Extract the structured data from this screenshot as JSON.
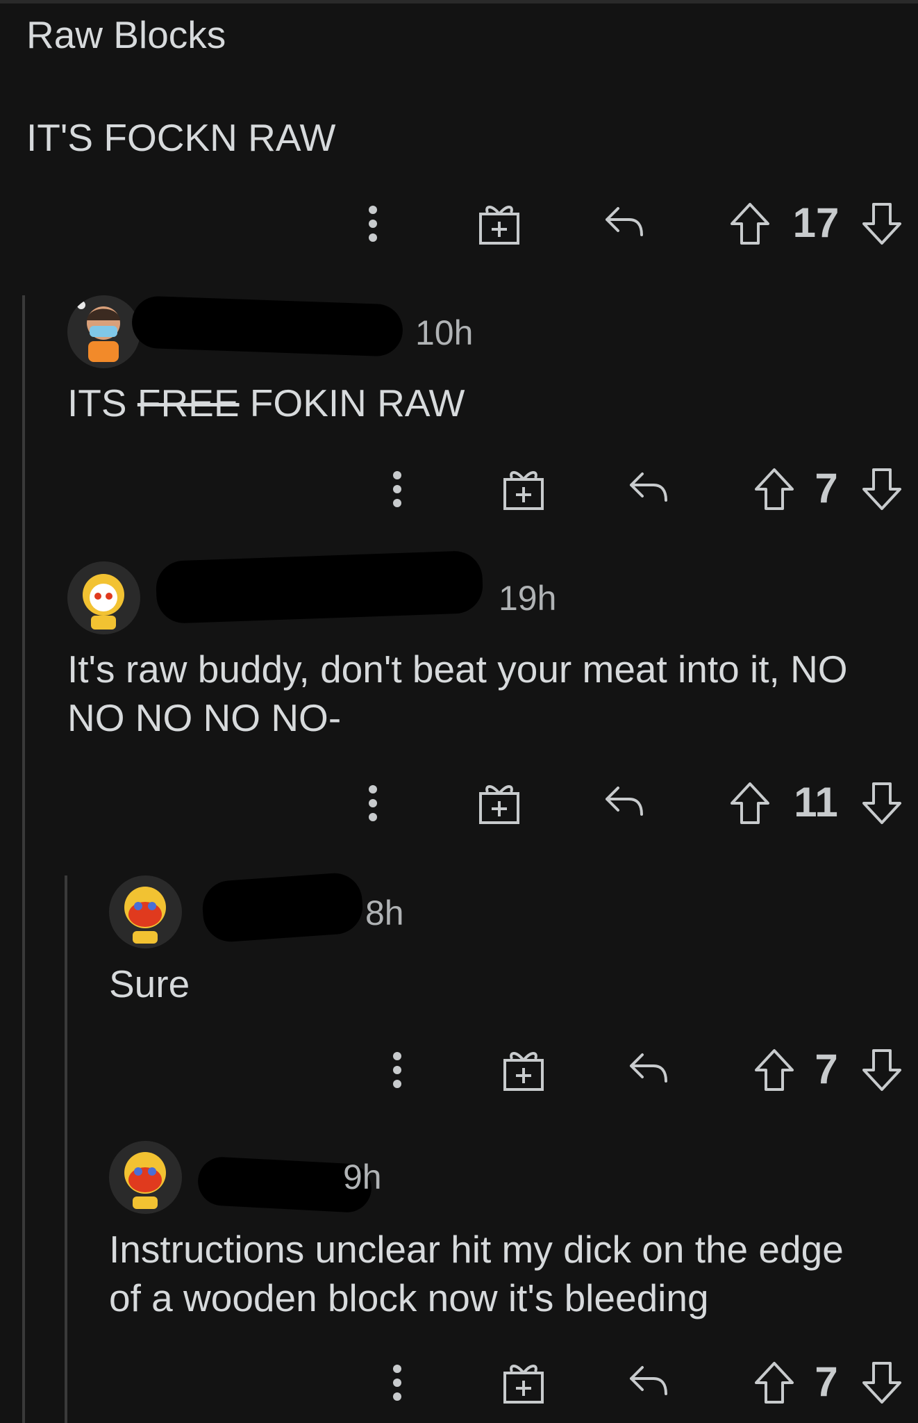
{
  "post": {
    "title": "Raw Blocks",
    "body": "IT'S FOCKN RAW",
    "score": "17"
  },
  "comments": [
    {
      "time": "10h",
      "text_prefix": "ITS ",
      "text_strike": "FREE",
      "text_suffix": " FOKIN RAW",
      "score": "7"
    },
    {
      "time": "19h",
      "line1": "It's raw buddy, don't beat your meat into it, NO",
      "line2": "NO NO NO NO-",
      "score": "11"
    },
    {
      "time": "8h",
      "text": "Sure",
      "score": "7"
    },
    {
      "time": "9h",
      "line1": "Instructions unclear hit my dick on the edge",
      "line2": "of a wooden block now it's bleeding",
      "score": "7"
    }
  ],
  "icons": [
    "more-icon",
    "award-icon",
    "reply-icon",
    "upvote-icon",
    "downvote-icon",
    "avatar-icon"
  ]
}
